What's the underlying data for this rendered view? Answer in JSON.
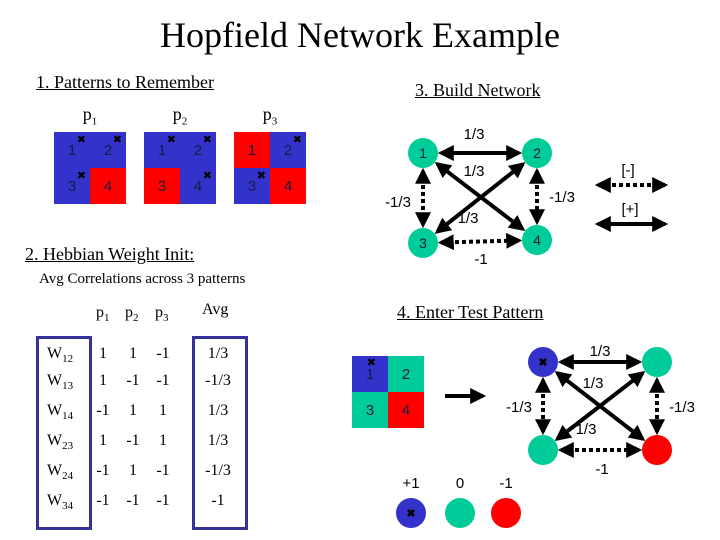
{
  "title": "Hopfield Network Example",
  "colors": {
    "blue": "#3333cc",
    "red": "#ff0000",
    "teal": "#00cc99",
    "box": "#333399"
  },
  "section1": {
    "heading": "1. Patterns to Remember",
    "patterns": [
      {
        "label": "p",
        "sub": "1",
        "cells": [
          {
            "n": "1",
            "state": "blue",
            "mark": true
          },
          {
            "n": "2",
            "state": "blue",
            "mark": true
          },
          {
            "n": "3",
            "state": "blue",
            "mark": true
          },
          {
            "n": "4",
            "state": "red",
            "mark": false
          }
        ]
      },
      {
        "label": "p",
        "sub": "2",
        "cells": [
          {
            "n": "1",
            "state": "blue",
            "mark": true
          },
          {
            "n": "2",
            "state": "blue",
            "mark": true
          },
          {
            "n": "3",
            "state": "red",
            "mark": false
          },
          {
            "n": "4",
            "state": "blue",
            "mark": true
          }
        ]
      },
      {
        "label": "p",
        "sub": "3",
        "cells": [
          {
            "n": "1",
            "state": "red",
            "mark": false
          },
          {
            "n": "2",
            "state": "blue",
            "mark": true
          },
          {
            "n": "3",
            "state": "blue",
            "mark": true
          },
          {
            "n": "4",
            "state": "red",
            "mark": false
          }
        ]
      }
    ]
  },
  "section2": {
    "heading": "2. Hebbian Weight Init:",
    "note": "Avg Correlations across 3 patterns",
    "columns": {
      "p1": "p",
      "p1_sub": "1",
      "p2": "p",
      "p2_sub": "2",
      "p3": "p",
      "p3_sub": "3",
      "avg": "Avg"
    },
    "rows": [
      {
        "w": "W",
        "sub": "12",
        "p1": "1",
        "p2": "1",
        "p3": "-1",
        "avg": "1/3"
      },
      {
        "w": "W",
        "sub": "13",
        "p1": "1",
        "p2": "-1",
        "p3": "-1",
        "avg": "-1/3"
      },
      {
        "w": "W",
        "sub": "14",
        "p1": "-1",
        "p2": "1",
        "p3": "1",
        "avg": "1/3"
      },
      {
        "w": "W",
        "sub": "23",
        "p1": "1",
        "p2": "-1",
        "p3": "1",
        "avg": "1/3"
      },
      {
        "w": "W",
        "sub": "24",
        "p1": "-1",
        "p2": "1",
        "p3": "-1",
        "avg": "-1/3"
      },
      {
        "w": "W",
        "sub": "34",
        "p1": "-1",
        "p2": "-1",
        "p3": "-1",
        "avg": "-1"
      }
    ]
  },
  "section3": {
    "heading": "3. Build Network",
    "nodes": [
      "1",
      "2",
      "3",
      "4"
    ],
    "edges": {
      "w12": "1/3",
      "w14": "1/3",
      "w23": "1/3",
      "w13": "-1/3",
      "w24": "-1/3",
      "w34": "-1"
    },
    "legend": {
      "negative": "[-]",
      "positive": "[+]"
    }
  },
  "section4": {
    "heading": "4. Enter Test Pattern",
    "test_cells": [
      {
        "n": "1",
        "state": "blue",
        "mark": true
      },
      {
        "n": "2",
        "state": "teal",
        "mark": false
      },
      {
        "n": "3",
        "state": "teal",
        "mark": false
      },
      {
        "n": "4",
        "state": "red",
        "mark": false
      }
    ],
    "node_states": [
      "blue",
      "teal",
      "teal",
      "red"
    ],
    "edges": {
      "w12": "1/3",
      "w14": "1/3",
      "w23": "1/3",
      "w13": "-1/3",
      "w24": "-1/3",
      "w34": "-1"
    },
    "legend": [
      {
        "label": "+1",
        "state": "blue",
        "mark": true
      },
      {
        "label": "0",
        "state": "teal",
        "mark": false
      },
      {
        "label": "-1",
        "state": "red",
        "mark": false
      }
    ]
  }
}
